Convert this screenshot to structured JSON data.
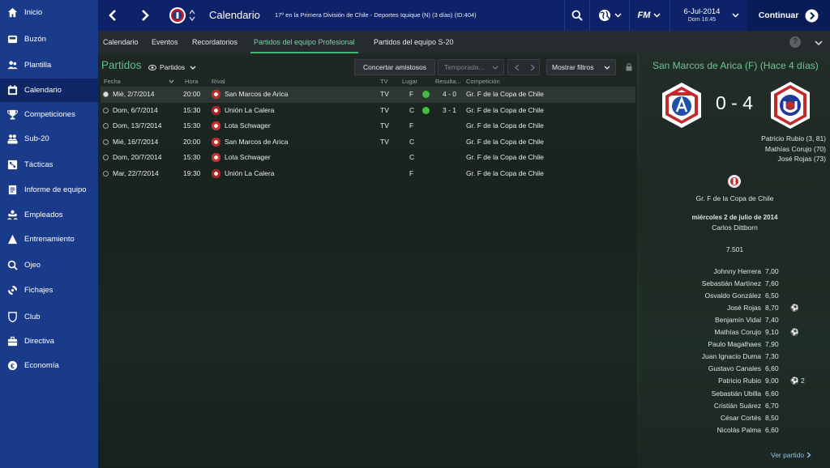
{
  "sidebar": {
    "items": [
      {
        "label": "Inicio",
        "icon": "home-icon"
      },
      {
        "label": "Buzón",
        "icon": "inbox-icon"
      },
      {
        "label": "Plantilla",
        "icon": "squad-icon"
      },
      {
        "label": "Calendario",
        "icon": "calendar-icon",
        "active": true
      },
      {
        "label": "Competiciones",
        "icon": "trophy-icon"
      },
      {
        "label": "Sub-20",
        "icon": "u20-icon"
      },
      {
        "label": "Tácticas",
        "icon": "tactics-icon"
      },
      {
        "label": "Informe de equipo",
        "icon": "report-icon"
      },
      {
        "label": "Empleados",
        "icon": "staff-icon"
      },
      {
        "label": "Entrenamiento",
        "icon": "training-icon"
      },
      {
        "label": "Ojeo",
        "icon": "scouting-icon"
      },
      {
        "label": "Fichajes",
        "icon": "transfers-icon"
      },
      {
        "label": "Club",
        "icon": "club-icon"
      },
      {
        "label": "Directiva",
        "icon": "board-icon"
      },
      {
        "label": "Economía",
        "icon": "finance-icon"
      }
    ]
  },
  "topbar": {
    "title": "Calendario",
    "subtitle": "17º en la Primera División de Chile - Deportes Iquique (N) (3 días) (ID:404)",
    "date": "6-Jul-2014",
    "time": "Dom 16:45",
    "continue_label": "Continuar",
    "fm_label": "FM"
  },
  "subtabs": [
    {
      "label": "Calendario"
    },
    {
      "label": "Eventos"
    },
    {
      "label": "Recordatorios"
    },
    {
      "label": "Partidos del equipo Profesional",
      "active": true
    },
    {
      "label": "Partidos del equipo S-20"
    }
  ],
  "matches": {
    "heading": "Partidos",
    "view_dropdown": "Partidos",
    "arrange_btn": "Concertar amistosos",
    "season_placeholder": "Temporada...",
    "filters_btn": "Mostrar filtros",
    "columns": {
      "fecha": "Fecha",
      "hora": "Hora",
      "rival": "Rival",
      "tv": "TV",
      "lugar": "Lugar",
      "resultado": "Resulta...",
      "competicion": "Competición"
    },
    "rows": [
      {
        "fecha": "Mié, 2/7/2014",
        "hora": "20:00",
        "rival": "San Marcos de Arica",
        "tv": "TV",
        "lugar": "F",
        "result_dot": true,
        "resultado": "4 - 0",
        "competicion": "Gr. F de la Copa de Chile",
        "selected": true
      },
      {
        "fecha": "Dom, 6/7/2014",
        "hora": "15:30",
        "rival": "Unión La Calera",
        "tv": "TV",
        "lugar": "C",
        "result_dot": true,
        "resultado": "3 - 1",
        "competicion": "Gr. F de la Copa de Chile"
      },
      {
        "fecha": "Dom, 13/7/2014",
        "hora": "15:30",
        "rival": "Lota Schwager",
        "tv": "TV",
        "lugar": "F",
        "result_dot": false,
        "resultado": "",
        "competicion": "Gr. F de la Copa de Chile"
      },
      {
        "fecha": "Mié, 16/7/2014",
        "hora": "20:00",
        "rival": "San Marcos de Arica",
        "tv": "TV",
        "lugar": "C",
        "result_dot": false,
        "resultado": "",
        "competicion": "Gr. F de la Copa de Chile"
      },
      {
        "fecha": "Dom, 20/7/2014",
        "hora": "15:30",
        "rival": "Lota Schwager",
        "tv": "",
        "lugar": "C",
        "result_dot": false,
        "resultado": "",
        "competicion": "Gr. F de la Copa de Chile"
      },
      {
        "fecha": "Mar, 22/7/2014",
        "hora": "19:30",
        "rival": "Unión La Calera",
        "tv": "",
        "lugar": "F",
        "result_dot": false,
        "resultado": "",
        "competicion": "Gr. F de la Copa de Chile"
      }
    ]
  },
  "detail": {
    "heading": "San Marcos de Arica (F) (Hace 4 días)",
    "score": "0 - 4",
    "scorers": [
      "Patricio Rubio (3, 81)",
      "Mathías Corujo (70)",
      "José Rojas (73)"
    ],
    "competition": "Gr. F de la Copa de Chile",
    "date": "miércoles 2 de julio de 2014",
    "referee": "Carlos Dittborn",
    "attendance": "7.501",
    "players": [
      {
        "name": "Johnny Herrera",
        "rating": "7,00",
        "extra": ""
      },
      {
        "name": "Sebastián Martínez",
        "rating": "7,60",
        "extra": ""
      },
      {
        "name": "Osvaldo González",
        "rating": "6,50",
        "extra": ""
      },
      {
        "name": "José Rojas",
        "rating": "8,70",
        "extra": "⚽"
      },
      {
        "name": "Benjamín Vidal",
        "rating": "7,40",
        "extra": ""
      },
      {
        "name": "Mathías Corujo",
        "rating": "9,10",
        "extra": "⚽"
      },
      {
        "name": "Paulo Magalhaes",
        "rating": "7,90",
        "extra": ""
      },
      {
        "name": "Juan Ignacio Duma",
        "rating": "7,30",
        "extra": ""
      },
      {
        "name": "Gustavo Canales",
        "rating": "6,60",
        "extra": ""
      },
      {
        "name": "Patricio Rubio",
        "rating": "9,00",
        "extra": "⚽ 2"
      },
      {
        "name": "Sebastián Ubilla",
        "rating": "6,60",
        "extra": ""
      },
      {
        "name": "Cristián Suárez",
        "rating": "6,70",
        "extra": ""
      },
      {
        "name": "César Cortés",
        "rating": "8,50",
        "extra": ""
      },
      {
        "name": "Nicolás Palma",
        "rating": "6,60",
        "extra": ""
      }
    ],
    "view_match_link": "Ver partido"
  }
}
